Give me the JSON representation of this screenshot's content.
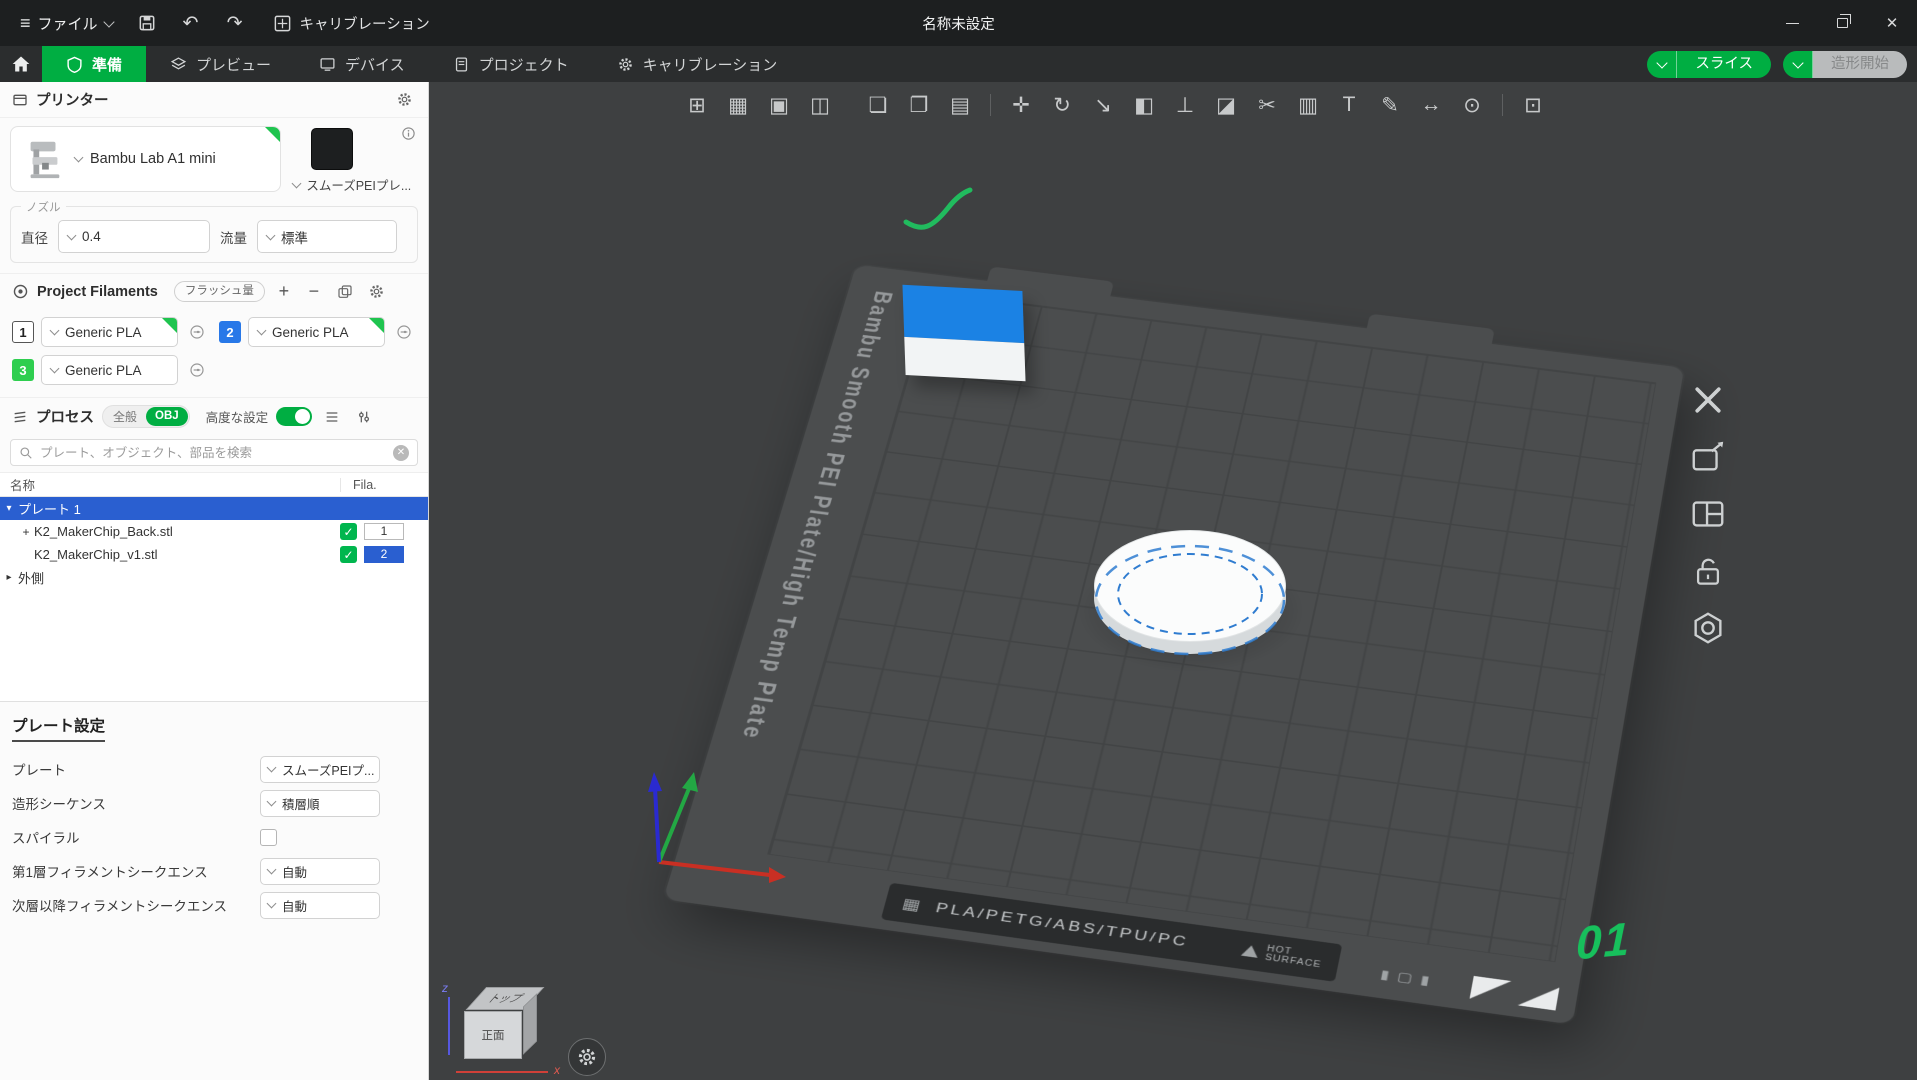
{
  "colors": {
    "accent_green": "#00ae42",
    "selection_blue": "#2a5fd0",
    "filament_blue": "#2878e8",
    "filament_green": "#2ece4f"
  },
  "icons": {
    "hamburger": "≡",
    "undo": "↶",
    "redo": "↷",
    "minimize_name": "minimize",
    "close": "✕",
    "plus": "+",
    "minus": "−",
    "caret_down": "▾",
    "caret_right": "▸",
    "check": "✓",
    "clear": "✕",
    "strip_grid": "▦",
    "mini_sq1": "▮",
    "mini_sq2": "▢",
    "mini_sq3": "▮"
  },
  "titlebar": {
    "file_menu": "ファイル",
    "calibration": "キャリブレーション",
    "title": "名称未設定"
  },
  "tabs": {
    "prepare": "準備",
    "preview": "プレビュー",
    "device": "デバイス",
    "project": "プロジェクト",
    "calibration": "キャリブレーション",
    "slice": "スライス",
    "print": "造形開始"
  },
  "sidebar": {
    "printer": {
      "header": "プリンター",
      "name": "Bambu Lab A1 mini",
      "plate": "スムーズPEIプレ...",
      "nozzle": "ノズル",
      "diameter_label": "直径",
      "diameter": "0.4",
      "flow_label": "流量",
      "flow": "標準"
    },
    "filaments": {
      "header": "Project Filaments",
      "flush": "フラッシュ量",
      "items": [
        {
          "no": "1",
          "name": "Generic PLA"
        },
        {
          "no": "2",
          "name": "Generic PLA"
        },
        {
          "no": "3",
          "name": "Generic PLA"
        }
      ]
    },
    "process": {
      "header": "プロセス",
      "seg_global": "全般",
      "seg_obj": "OBJ",
      "advanced": "高度な設定",
      "search_placeholder": "プレート、オブジェクト、部品を検索",
      "col_name": "名称",
      "col_fila": "Fila.",
      "rows": [
        {
          "label": "プレート 1"
        },
        {
          "prefix": "+",
          "label": "K2_MakerChip_Back.stl",
          "fila": "1"
        },
        {
          "prefix": "",
          "label": "K2_MakerChip_v1.stl",
          "fila": "2"
        },
        {
          "label": "外側"
        }
      ]
    },
    "plate_settings": {
      "header": "プレート設定",
      "rows": [
        {
          "label": "プレート",
          "value": "スムーズPEIプ..."
        },
        {
          "label": "造形シーケンス",
          "value": "積層順"
        },
        {
          "label": "スパイラル",
          "value": ""
        },
        {
          "label": "第1層フィラメントシークエンス",
          "value": "自動"
        },
        {
          "label": "次層以降フィラメントシークエンス",
          "value": "自動"
        }
      ]
    }
  },
  "viewport": {
    "toolbar": [
      {
        "name": "add",
        "g": "⊞"
      },
      {
        "name": "add-plate",
        "g": "▦"
      },
      {
        "name": "auto-orient",
        "g": "▣"
      },
      {
        "name": "split-to-objects",
        "g": "◫"
      },
      {
        "name": "copy",
        "g": "❏"
      },
      {
        "name": "paste",
        "g": "❐"
      },
      {
        "name": "import",
        "g": "▤"
      },
      {
        "name": "move",
        "g": "✛"
      },
      {
        "name": "rotate",
        "g": "↻"
      },
      {
        "name": "scale",
        "g": "↘"
      },
      {
        "name": "mirror",
        "g": "◧"
      },
      {
        "name": "lay-on-face",
        "g": "⊥"
      },
      {
        "name": "split",
        "g": "◪"
      },
      {
        "name": "cut",
        "g": "✂"
      },
      {
        "name": "variable-layer",
        "g": "▥"
      },
      {
        "name": "text",
        "g": "T"
      },
      {
        "name": "paint",
        "g": "✎"
      },
      {
        "name": "measure",
        "g": "↔"
      },
      {
        "name": "seam",
        "g": "⊙"
      },
      {
        "name": "assembly-view",
        "g": "⊡"
      }
    ],
    "plate": {
      "side_text": "Bambu Smooth PEI Plate/High Temp Plate",
      "material_text": "PLA/PETG/ABS/TPU/PC",
      "hot_line1": "HOT",
      "hot_line2": "SURFACE",
      "number": "01"
    },
    "navcube": {
      "top": "トップ",
      "front": "正面",
      "axis_z": "z",
      "axis_x": "x"
    }
  }
}
